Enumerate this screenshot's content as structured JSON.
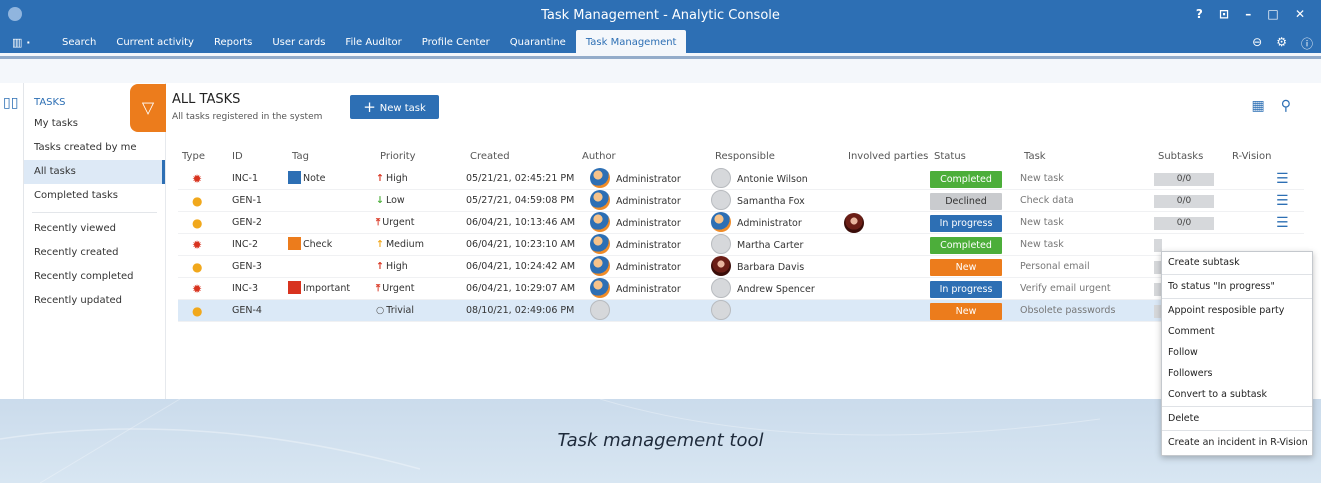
{
  "window": {
    "title": "Task Management - Analytic Console",
    "controls": "? ⊡ – □ ✕"
  },
  "menubar": {
    "app_menu": "▥ ·",
    "tabs": [
      "Search",
      "Current activity",
      "Reports",
      "User cards",
      "File Auditor",
      "Profile Center",
      "Quarantine",
      "Task Management"
    ],
    "active_tab": "Task Management",
    "right_icons": [
      "⊖",
      "⚙",
      "ⓘ"
    ]
  },
  "sidebar": {
    "section": "TASKS",
    "items": [
      "My tasks",
      "Tasks created by me",
      "All tasks",
      "Completed tasks"
    ],
    "items2": [
      "Recently viewed",
      "Recently created",
      "Recently completed",
      "Recently updated"
    ],
    "active": "All tasks"
  },
  "header": {
    "title": "ALL TASKS",
    "subtitle": "All tasks registered in the system",
    "new_task": "New task"
  },
  "columns": [
    "Type",
    "ID",
    "Tag",
    "Priority",
    "Created",
    "Author",
    "Responsible",
    "Involved parties",
    "Status",
    "Task",
    "Subtasks",
    "R-Vision"
  ],
  "rows": [
    {
      "id": "INC-1",
      "tag": "Note",
      "tag_color": "#2d6fb4",
      "priority": "High",
      "prio_symbol": "↑",
      "prio_color": "#d8331f",
      "created": "05/21/21, 02:45:21 PM",
      "author": "Administrator",
      "responsible": "Antonie Wilson",
      "status": "Completed",
      "task": "New task",
      "subtasks": "0/0"
    },
    {
      "id": "GEN-1",
      "tag": "",
      "tag_color": "",
      "priority": "Low",
      "prio_symbol": "↓",
      "prio_color": "#4cae3a",
      "created": "05/27/21, 04:59:08 PM",
      "author": "Administrator",
      "responsible": "Samantha Fox",
      "status": "Declined",
      "task": "Check data",
      "subtasks": "0/0"
    },
    {
      "id": "GEN-2",
      "tag": "",
      "tag_color": "",
      "priority": "Urgent",
      "prio_symbol": "⤒",
      "prio_color": "#d8331f",
      "created": "06/04/21, 10:13:46 AM",
      "author": "Administrator",
      "responsible": "Administrator",
      "status": "In progress",
      "task": "New task",
      "subtasks": "0/0"
    },
    {
      "id": "INC-2",
      "tag": "Check",
      "tag_color": "#ec7c1c",
      "priority": "Medium",
      "prio_symbol": "↑",
      "prio_color": "#f1a81c",
      "created": "06/04/21, 10:23:10 AM",
      "author": "Administrator",
      "responsible": "Martha Carter",
      "status": "Completed",
      "task": "New task",
      "subtasks": ""
    },
    {
      "id": "GEN-3",
      "tag": "",
      "tag_color": "",
      "priority": "High",
      "prio_symbol": "↑",
      "prio_color": "#d8331f",
      "created": "06/04/21, 10:24:42 AM",
      "author": "Administrator",
      "responsible": "Barbara Davis",
      "status": "New",
      "task": "Personal email",
      "subtasks": ""
    },
    {
      "id": "INC-3",
      "tag": "Important",
      "tag_color": "#d8331f",
      "priority": "Urgent",
      "prio_symbol": "⤒",
      "prio_color": "#d8331f",
      "created": "06/04/21, 10:29:07 AM",
      "author": "Administrator",
      "responsible": "Andrew Spencer",
      "status": "In progress",
      "task": "Verify email urgent",
      "subtasks": ""
    },
    {
      "id": "GEN-4",
      "tag": "",
      "tag_color": "",
      "priority": "Trivial",
      "prio_symbol": "○",
      "prio_color": "#555",
      "created": "08/10/21, 02:49:06 PM",
      "author": "",
      "responsible": "",
      "status": "New",
      "task": "Obsolete passwords",
      "subtasks": ""
    }
  ],
  "context_menu": {
    "group1": [
      "Create subtask"
    ],
    "group2": [
      "To status \"In progress\""
    ],
    "group3": [
      "Appoint resposible party",
      "Comment",
      "Follow",
      "Followers",
      "Convert to a subtask"
    ],
    "group4": [
      "Delete"
    ],
    "group5": [
      "Create an incident in R-Vision"
    ]
  },
  "caption": "Task management tool"
}
